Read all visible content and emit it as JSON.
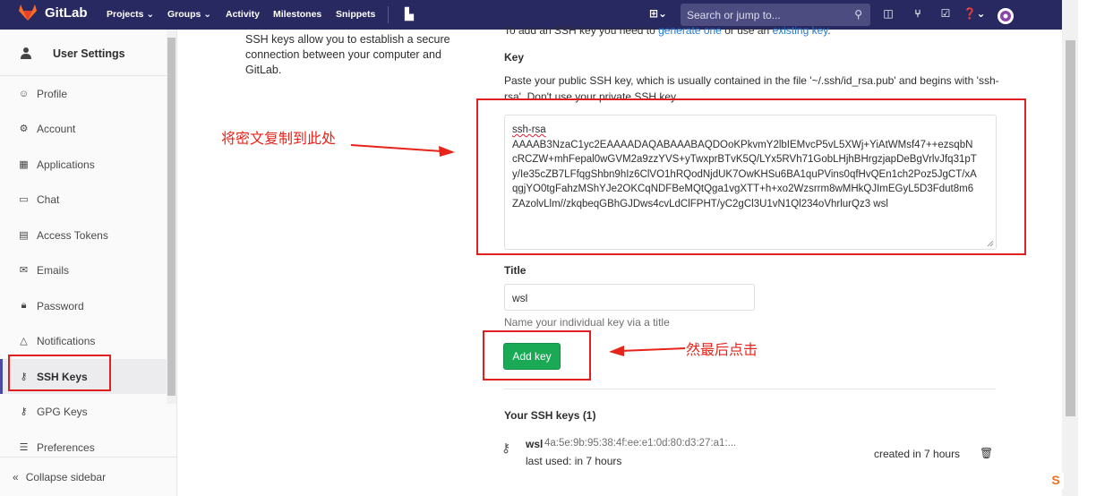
{
  "navbar": {
    "brand": "GitLab",
    "links": [
      "Projects",
      "Groups",
      "Activity",
      "Milestones",
      "Snippets"
    ],
    "search_placeholder": "Search or jump to..."
  },
  "sidebar": {
    "title": "User Settings",
    "items": [
      {
        "label": "Profile",
        "icon": "profile-icon"
      },
      {
        "label": "Account",
        "icon": "account-icon"
      },
      {
        "label": "Applications",
        "icon": "applications-icon"
      },
      {
        "label": "Chat",
        "icon": "chat-icon"
      },
      {
        "label": "Access Tokens",
        "icon": "token-icon"
      },
      {
        "label": "Emails",
        "icon": "mail-icon"
      },
      {
        "label": "Password",
        "icon": "lock-icon"
      },
      {
        "label": "Notifications",
        "icon": "bell-icon"
      },
      {
        "label": "SSH Keys",
        "icon": "key-icon"
      },
      {
        "label": "GPG Keys",
        "icon": "key-icon"
      },
      {
        "label": "Preferences",
        "icon": "preferences-icon"
      }
    ],
    "collapse_label": "Collapse sidebar"
  },
  "main": {
    "intro": "SSH keys allow you to establish a secure connection between your computer and GitLab.",
    "top_cut_prefix": "To add an SSH key you need to ",
    "top_cut_link1": "generate one",
    "top_cut_mid": " or use an ",
    "top_cut_link2": "existing key",
    "top_cut_suffix": ".",
    "key_label": "Key",
    "key_description": "Paste your public SSH key, which is usually contained in the file '~/.ssh/id_rsa.pub' and begins with 'ssh-rsa'. Don't use your private SSH key.",
    "key_value_lines": [
      "ssh-rsa",
      "AAAAB3NzaC1yc2EAAAADAQABAAABAQDOoKPkvmY2lbIEMvcP5vL5XWj+YiAtWMsf47++ezsqbN",
      "cRCZW+mhFepal0wGVM2a9zzYVS+yTwxprBTvK5Q/LYx5RVh71GobLHjhBHrgzjapDeBgVrlvJfq31pT",
      "y/Ie35cZB7LFfqgShbn9hIz6ClVO1hRQodNjdUK7OwKHSu6BA1quPVins0qfHvQEn1ch2Poz5JgCT/xA",
      "qgjYO0tgFahzMShYJe2OKCqNDFBeMQtQga1vgXTT+h+xo2Wzsrrm8wMHkQJImEGyL5D3Fdut8m6",
      "ZAzolvLlm//zkqbeqGBhGJDws4cvLdClFPHT/yC2gCl3U1vN1Ql234oVhrlurQz3 wsl"
    ],
    "title_label": "Title",
    "title_value": "wsl",
    "title_hint": "Name your individual key via a title",
    "add_key_label": "Add key",
    "your_keys_label": "Your SSH keys (1)",
    "key_entry": {
      "name": "wsl",
      "fingerprint": "4a:5e:9b:95:38:4f:ee:e1:0d:80:d3:27:a1:...",
      "last_used": "last used: in 7 hours",
      "created": "created in 7 hours"
    }
  },
  "annotations": {
    "paste_note": "将密文复制到此处",
    "click_note": "然最后点击"
  },
  "colors": {
    "navbar": "#292961",
    "accent_red": "#e02020",
    "button_green": "#1aaa55",
    "link": "#1f78d1"
  }
}
